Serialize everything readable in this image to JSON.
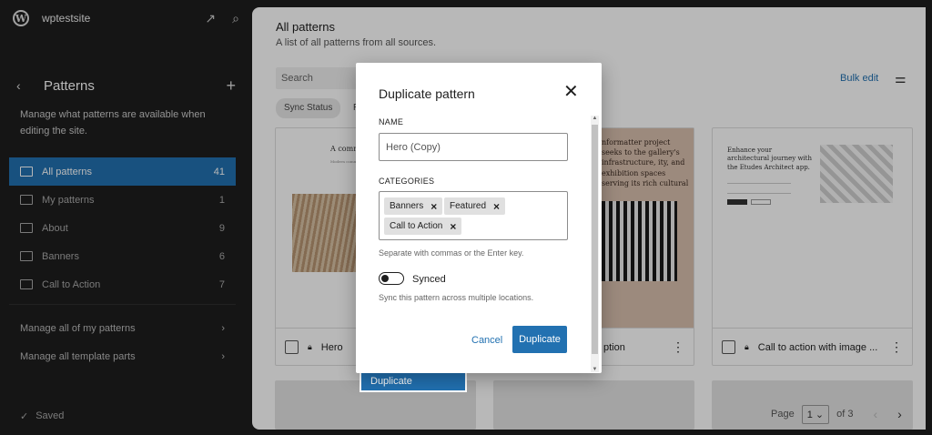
{
  "site": {
    "name": "wptestsite",
    "status": "Saved"
  },
  "sidebar": {
    "title": "Patterns",
    "description": "Manage what patterns are available when editing the site.",
    "items": [
      {
        "label": "All patterns",
        "count": "41",
        "active": true
      },
      {
        "label": "My patterns",
        "count": "1"
      },
      {
        "label": "About",
        "count": "9"
      },
      {
        "label": "Banners",
        "count": "6"
      },
      {
        "label": "Call to Action",
        "count": "7"
      }
    ],
    "links": [
      {
        "label": "Manage all of my patterns"
      },
      {
        "label": "Manage all template parts"
      }
    ]
  },
  "main": {
    "title": "All patterns",
    "subtitle": "A list of all patterns from all sources.",
    "search_placeholder": "Search",
    "filter_chip": "Sync Status",
    "filter_chip2": "R",
    "bulk_edit": "Bulk edit",
    "cards": [
      {
        "title": "Hero",
        "locked": true,
        "preview_heading": "A commi",
        "preview_line": "Modern commit"
      },
      {
        "title": "ption",
        "locked": true,
        "preview_text": "nformatter project seeks to the gallery's infrastructure, ity, and exhibition spaces serving its rich cultural"
      },
      {
        "title": "Call to action with image ...",
        "locked": true,
        "preview_text": "Enhance your architectural journey with the Etudes Architect app."
      }
    ],
    "pager": {
      "label": "Page",
      "current": "1",
      "of": "of 3"
    }
  },
  "ghost_button": "Duplicate",
  "modal": {
    "title": "Duplicate pattern",
    "name_label": "NAME",
    "name_value": "Hero (Copy)",
    "categories_label": "CATEGORIES",
    "categories": [
      "Banners",
      "Featured",
      "Call to Action"
    ],
    "categories_help": "Separate with commas or the Enter key.",
    "synced_label": "Synced",
    "synced_on": false,
    "synced_help": "Sync this pattern across multiple locations.",
    "cancel_label": "Cancel",
    "duplicate_label": "Duplicate"
  },
  "colors": {
    "accent": "#2271b1",
    "sidebar_bg": "#1e1e1e"
  }
}
